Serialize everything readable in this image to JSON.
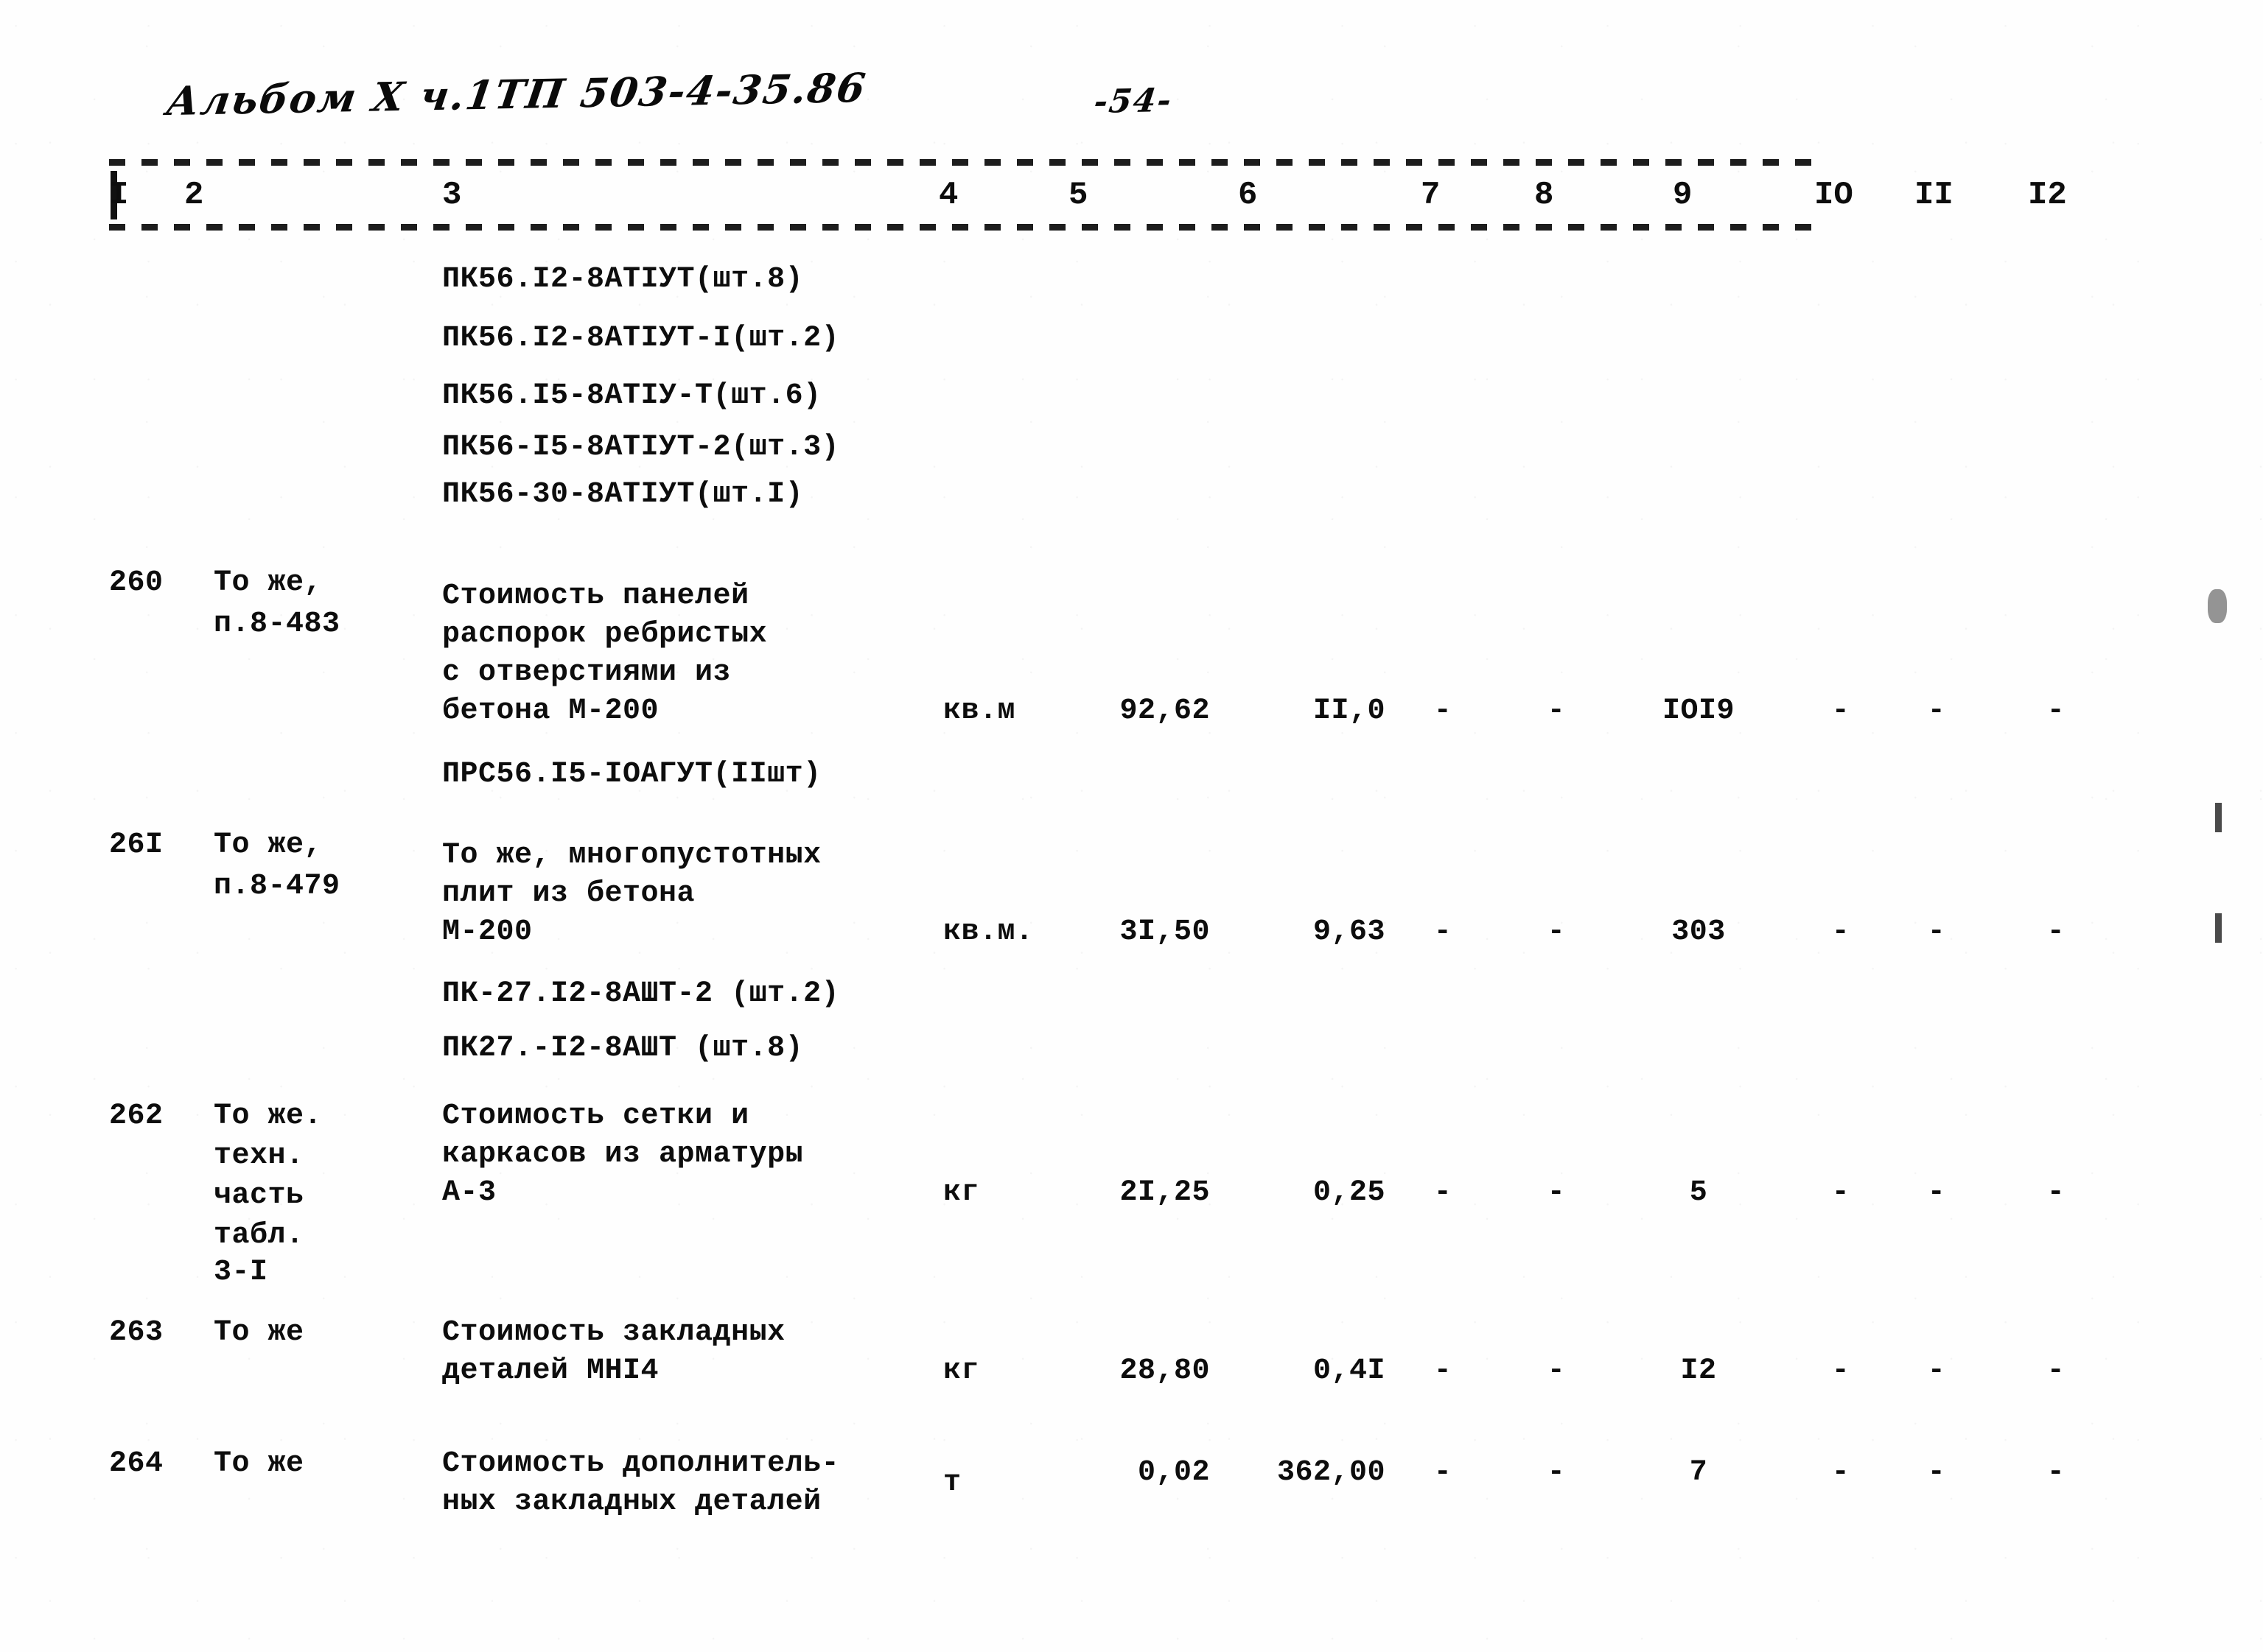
{
  "header": {
    "album_reference": "Альбом X ч.1ТП 503-4-35.86",
    "page_number": "-54-",
    "column_numbers": [
      "I",
      "2",
      "3",
      "4",
      "5",
      "6",
      "7",
      "8",
      "9",
      "IO",
      "II",
      "I2"
    ]
  },
  "continued_codes": {
    "lines": [
      "ПК56.I2-8АТIУТ(шт.8)",
      "ПК56.I2-8АТIУТ-I(шт.2)",
      "ПК56.I5-8АТIУ-Т(шт.6)",
      "ПК56-I5-8АТIУТ-2(шт.3)",
      "ПК56-30-8АТIУТ(шт.I)"
    ]
  },
  "rows": [
    {
      "num": "260",
      "justification": [
        "То же,",
        "п.8-483"
      ],
      "description": [
        "Стоимость панелей",
        "распорок ребристых",
        "с отверстиями из",
        "бетона М-200"
      ],
      "extra_codes": [
        "ПРС56.I5-IOАГУТ(IIшт)"
      ],
      "unit": "кв.м",
      "quantity": "92,62",
      "price": "II,0",
      "col7": "-",
      "col8": "-",
      "col9": "IOI9",
      "col10": "-",
      "col11": "-",
      "col12": "-"
    },
    {
      "num": "26I",
      "justification": [
        "То же,",
        "п.8-479"
      ],
      "description": [
        "То же, многопустотных",
        "плит из бетона",
        "М-200"
      ],
      "extra_codes": [
        "ПК-27.I2-8АШТ-2 (шт.2)",
        "ПК27.-I2-8АШТ (шт.8)"
      ],
      "unit": "кв.м.",
      "quantity": "3I,50",
      "price": "9,63",
      "col7": "-",
      "col8": "-",
      "col9": "303",
      "col10": "-",
      "col11": "-",
      "col12": "-"
    },
    {
      "num": "262",
      "justification": [
        "То же.",
        "техн.",
        "часть",
        "табл.",
        "3-I"
      ],
      "description": [
        "Стоимость сетки и",
        "каркасов из арматуры",
        "А-3"
      ],
      "extra_codes": [],
      "unit": "кг",
      "quantity": "2I,25",
      "price": "0,25",
      "col7": "-",
      "col8": "-",
      "col9": "5",
      "col10": "-",
      "col11": "-",
      "col12": "-"
    },
    {
      "num": "263",
      "justification": [
        "То же"
      ],
      "description": [
        "Стоимость закладных",
        "деталей МНI4"
      ],
      "extra_codes": [],
      "unit": "кг",
      "quantity": "28,80",
      "price": "0,4I",
      "col7": "-",
      "col8": "-",
      "col9": "I2",
      "col10": "-",
      "col11": "-",
      "col12": "-"
    },
    {
      "num": "264",
      "justification": [
        "То же"
      ],
      "description": [
        "Стоимость дополнитель-",
        "ных закладных деталей"
      ],
      "extra_codes": [],
      "unit": "т",
      "quantity": "0,02",
      "price": "362,00",
      "col7": "-",
      "col8": "-",
      "col9": "7",
      "col10": "-",
      "col11": "-",
      "col12": "-"
    }
  ]
}
